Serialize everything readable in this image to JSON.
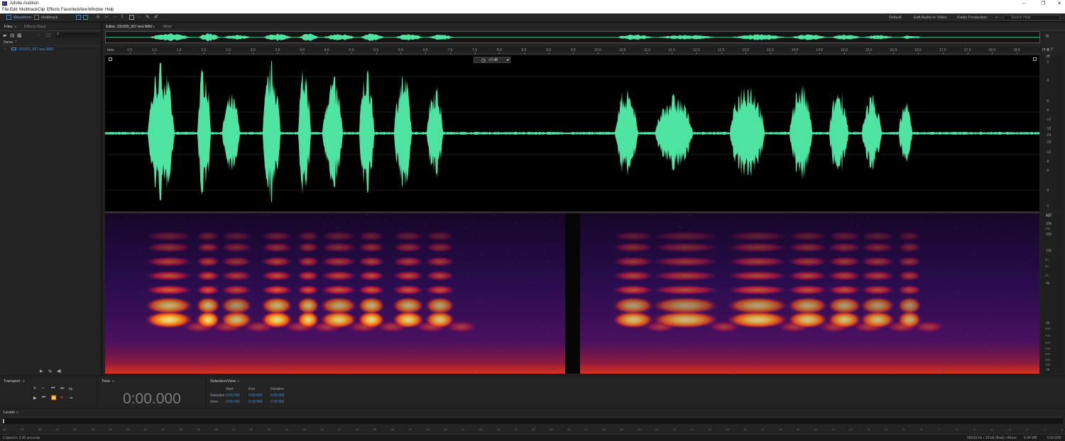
{
  "app": {
    "title": "Adobe Audition",
    "icon_text": "Au"
  },
  "menu": [
    "File",
    "Edit",
    "Multitrack",
    "Clip",
    "Effects",
    "Favorites",
    "View",
    "Window",
    "Help"
  ],
  "toolbar": {
    "waveform_label": "Waveform",
    "multitrack_label": "Multitrack",
    "workspaces": [
      "Default",
      "Edit Audio to Video",
      "Radio Production"
    ],
    "more_glyph": "»",
    "search_placeholder": "Search Help"
  },
  "files_panel": {
    "tabs": [
      "Files",
      "Effects Rack"
    ],
    "column_header": "Name",
    "file_name": "231003_057 test.WAV"
  },
  "editor": {
    "tab_label": "Editor: 231003_057 test.WAV",
    "mixer_label": "Mixer",
    "gain_value": "+0 dB",
    "ruler_unit": "hms",
    "ruler_ticks": [
      "0.5",
      "1.0",
      "1.5",
      "2.0",
      "2.5",
      "3.0",
      "3.5",
      "4.0",
      "4.5",
      "5.0",
      "5.5",
      "6.0",
      "6.5",
      "7.0",
      "7.5",
      "8.0",
      "8.5",
      "9.0",
      "9.5",
      "10.0",
      "10.5",
      "11.0",
      "11.5",
      "12.0",
      "12.5",
      "13.0",
      "13.5",
      "14.0",
      "14.5",
      "15.0",
      "15.5",
      "16.0",
      "16.5",
      "17.0",
      "17.5",
      "18.0",
      "18.5"
    ],
    "db_scale": [
      "dB",
      "-1",
      "-3",
      "-6",
      "-9",
      "-12",
      "-18",
      "-24",
      "-18",
      "-12",
      "-9",
      "-6",
      "-3",
      "-1"
    ],
    "hz_scale": [
      "Hz",
      "30k",
      "20k",
      "10k",
      "4k",
      "2k",
      "1k",
      "100"
    ],
    "hz_minor": [
      "25k",
      "6k",
      "5k",
      "3k",
      "900",
      "700",
      "500",
      "400",
      "300",
      "200",
      "150"
    ]
  },
  "transport": {
    "label": "Transport",
    "buttons_row1": [
      "■",
      "⏸",
      "⏮",
      "⏭",
      "⇆"
    ],
    "buttons_row2": [
      "▶",
      "⏮",
      "⏩",
      "●",
      "⇥"
    ]
  },
  "time": {
    "label": "Time",
    "value": "0:00.000"
  },
  "selection_view": {
    "label": "Selection/View",
    "headers": [
      "Start",
      "End",
      "Duration"
    ],
    "rows": [
      {
        "name": "Selection",
        "start": "0:00.000",
        "end": "0:00.000",
        "duration": "0:00.000"
      },
      {
        "name": "View",
        "start": "0:00.000",
        "end": "0:18.956",
        "duration": "0:18.956"
      }
    ]
  },
  "levels": {
    "label": "Levels",
    "ticks": [
      "dB",
      "-59",
      "-58",
      "-57",
      "-56",
      "-55",
      "-54",
      "-53",
      "-52",
      "-51",
      "-50",
      "-49",
      "-48",
      "-47",
      "-46",
      "-45",
      "-44",
      "-43",
      "-42",
      "-41",
      "-40",
      "-39",
      "-38",
      "-37",
      "-36",
      "-35",
      "-34",
      "-33",
      "-32",
      "-31",
      "-30",
      "-29",
      "-28",
      "-27",
      "-26",
      "-25",
      "-24",
      "-23",
      "-22",
      "-21",
      "-20",
      "-19",
      "-18",
      "-17",
      "-16",
      "-15",
      "-14",
      "-13",
      "-12",
      "-11",
      "-10",
      "-9",
      "-8",
      "-7",
      "-6",
      "-5",
      "-4",
      "-3",
      "-2",
      "-1",
      "0"
    ]
  },
  "status": {
    "message": "Copied in 2.00 seconds",
    "format": "96000 Hz • 32-bit (float) • Mono",
    "size": "6.94 MB",
    "duration": "0:00.000"
  },
  "colors": {
    "waveform": "#4fe3a2",
    "spectral_bg": "#16062c",
    "selection_value": "#3e8ee0"
  }
}
